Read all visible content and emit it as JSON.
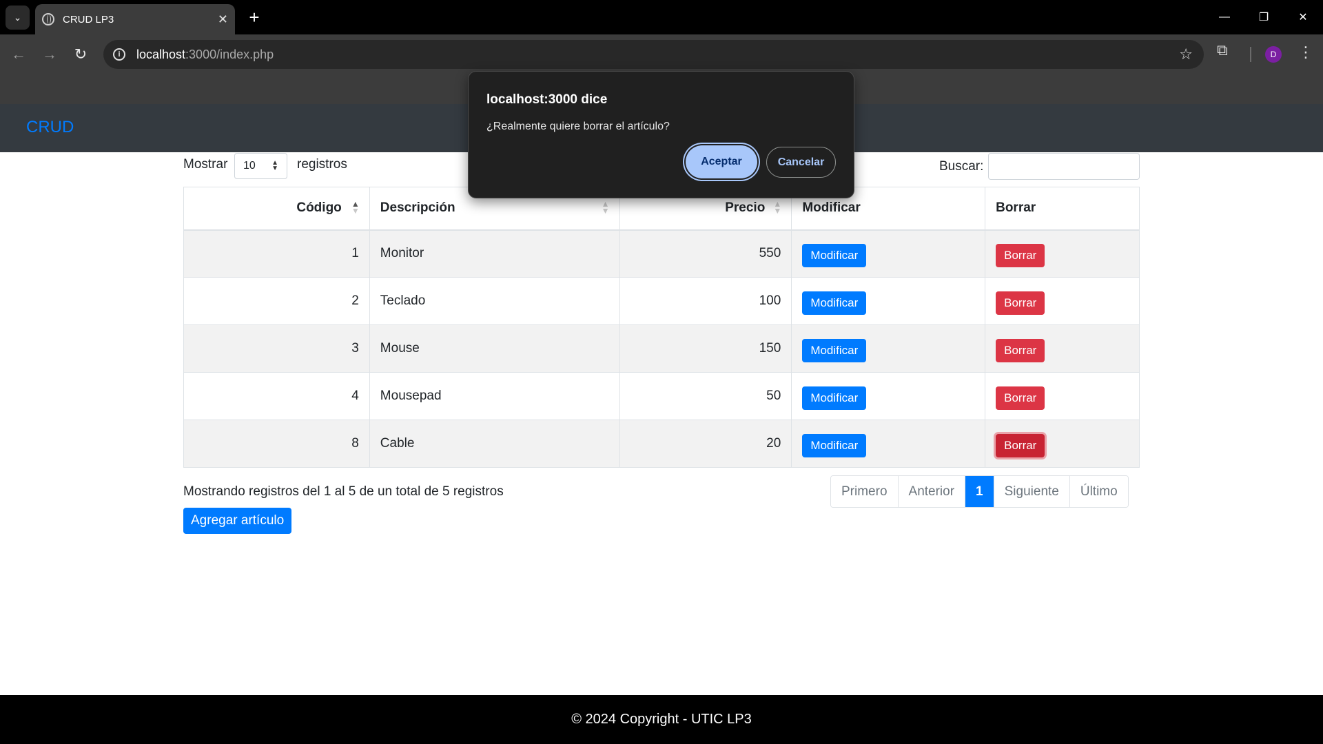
{
  "browser": {
    "tab_title": "CRUD LP3",
    "url_host": "localhost",
    "url_rest": ":3000/index.php",
    "profile_initial": "D"
  },
  "page": {
    "brand": "CRUD",
    "length_label_before": "Mostrar",
    "length_value": "10",
    "length_label_after": "registros",
    "search_label": "Buscar:",
    "columns": [
      "Código",
      "Descripción",
      "Precio",
      "Modificar",
      "Borrar"
    ],
    "rows": [
      {
        "codigo": "1",
        "descripcion": "Monitor",
        "precio": "550",
        "modificar": "Modificar",
        "borrar": "Borrar"
      },
      {
        "codigo": "2",
        "descripcion": "Teclado",
        "precio": "100",
        "modificar": "Modificar",
        "borrar": "Borrar"
      },
      {
        "codigo": "3",
        "descripcion": "Mouse",
        "precio": "150",
        "modificar": "Modificar",
        "borrar": "Borrar"
      },
      {
        "codigo": "4",
        "descripcion": "Mousepad",
        "precio": "50",
        "modificar": "Modificar",
        "borrar": "Borrar"
      },
      {
        "codigo": "8",
        "descripcion": "Cable",
        "precio": "20",
        "modificar": "Modificar",
        "borrar": "Borrar"
      }
    ],
    "info": "Mostrando registros del 1 al 5 de un total de 5 registros",
    "pagination": [
      "Primero",
      "Anterior",
      "1",
      "Siguiente",
      "Último"
    ],
    "active_page": "1",
    "add_button": "Agregar artículo",
    "footer": "© 2024 Copyright - UTIC LP3"
  },
  "dialog": {
    "title": "localhost:3000 dice",
    "message": "¿Realmente quiere borrar el artículo?",
    "ok": "Aceptar",
    "cancel": "Cancelar"
  },
  "colors": {
    "primary": "#007bff",
    "danger": "#dc3545",
    "navbar": "#343a40",
    "dialog_accent": "#a8c7fa"
  }
}
